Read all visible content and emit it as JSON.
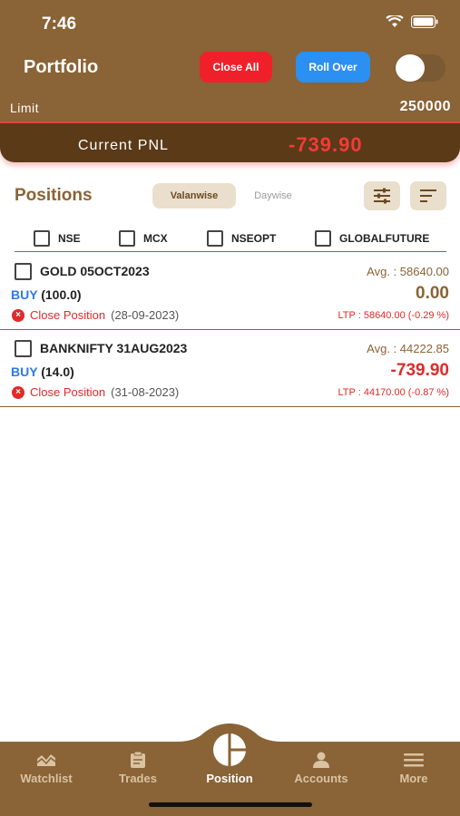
{
  "status_bar": {
    "time": "7:46"
  },
  "header": {
    "title": "Portfolio",
    "close_all_label": "Close All",
    "roll_over_label": "Roll Over",
    "limit_label": "Limit",
    "limit_value": "250000"
  },
  "pnl": {
    "label": "Current PNL",
    "value": "-739.90"
  },
  "positions": {
    "title": "Positions",
    "tabs": [
      {
        "label": "Valanwise",
        "active": true
      },
      {
        "label": "Daywise",
        "active": false
      }
    ],
    "filters": [
      "NSE",
      "MCX",
      "NSEOPT",
      "GLOBALFUTURE"
    ],
    "rows": [
      {
        "name": "GOLD 05OCT2023",
        "avg": "Avg. : 58640.00",
        "side": "BUY",
        "qty": "(100.0)",
        "pnl": "0.00",
        "close_label": "Close Position",
        "close_date": "(28-09-2023)",
        "ltp": "LTP : 58640.00 (-0.29 %)"
      },
      {
        "name": "BANKNIFTY 31AUG2023",
        "avg": "Avg. : 44222.85",
        "side": "BUY",
        "qty": "(14.0)",
        "pnl": "-739.90",
        "close_label": "Close Position",
        "close_date": "(31-08-2023)",
        "ltp": "LTP : 44170.00 (-0.87 %)"
      }
    ]
  },
  "nav": {
    "items": [
      {
        "label": "Watchlist",
        "icon": "watchlist-icon"
      },
      {
        "label": "Trades",
        "icon": "trades-icon"
      },
      {
        "label": "Position",
        "icon": "position-icon",
        "active": true
      },
      {
        "label": "Accounts",
        "icon": "accounts-icon"
      },
      {
        "label": "More",
        "icon": "more-icon"
      }
    ]
  },
  "colors": {
    "brand": "#8a6336",
    "brand_dark": "#5a3a17",
    "negative": "#f43a3a",
    "buy": "#2c7be5",
    "close_all": "#f0202a",
    "roll_over": "#2c8ff2"
  }
}
